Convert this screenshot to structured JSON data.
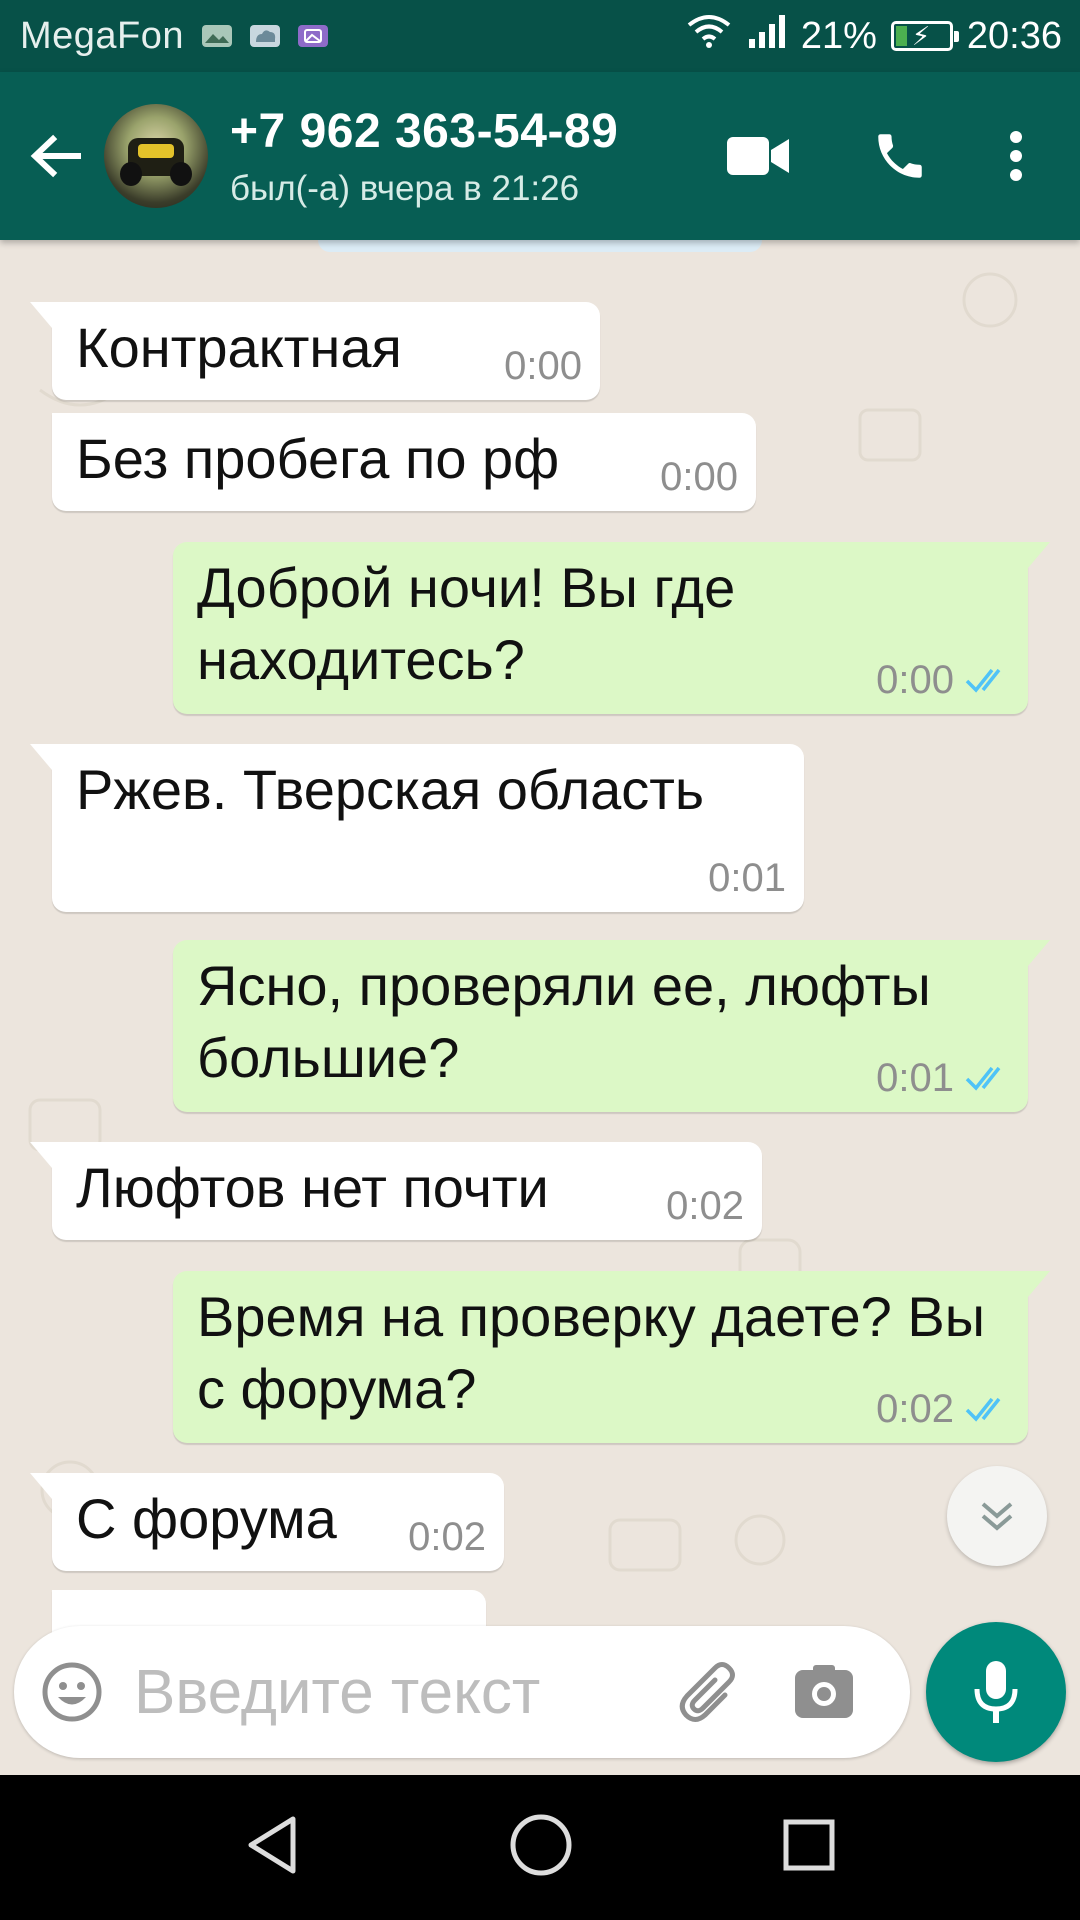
{
  "status_bar": {
    "carrier": "MegaFon",
    "battery": "21%",
    "battery_level": 0.21,
    "time": "20:36",
    "colors": {
      "bg": "#075148"
    }
  },
  "header": {
    "contact_name": "+7 962 363-54-89",
    "last_seen": "был(-а) вчера в 21:26",
    "colors": {
      "bg": "#075e54"
    }
  },
  "messages": [
    {
      "direction": "in",
      "text": "Контрактная",
      "time": "0:00"
    },
    {
      "direction": "in",
      "text": "Без пробега по рф",
      "time": "0:00"
    },
    {
      "direction": "out",
      "text": "Доброй ночи! Вы где находитесь?",
      "time": "0:00",
      "status": "read"
    },
    {
      "direction": "in",
      "text": "Ржев. Тверская область",
      "time": "0:01"
    },
    {
      "direction": "out",
      "text": "Ясно, проверяли ее, люфты большие?",
      "time": "0:01",
      "status": "read"
    },
    {
      "direction": "in",
      "text": "Люфтов нет почти",
      "time": "0:02"
    },
    {
      "direction": "out",
      "text": "Время на проверку даете? Вы с форума?",
      "time": "0:02",
      "status": "read"
    },
    {
      "direction": "in",
      "text": "С форума",
      "time": "0:02"
    }
  ],
  "composer": {
    "placeholder": "Введите текст",
    "value": ""
  },
  "colors": {
    "chat_bg": "#ece5dd",
    "incoming_bubble": "#ffffff",
    "outgoing_bubble": "#dcf8c6",
    "read_ticks": "#4fc3f7",
    "fab": "#00897b"
  },
  "icons": {
    "status_bar": [
      "image-icon",
      "cloud-icon",
      "gallery-icon",
      "wifi-icon",
      "signal-icon",
      "battery-icon"
    ],
    "header": [
      "back-arrow-icon",
      "video-call-icon",
      "phone-icon",
      "more-vert-icon"
    ],
    "composer": [
      "emoji-icon",
      "attach-icon",
      "camera-icon",
      "mic-icon"
    ],
    "navigation": [
      "nav-back-icon",
      "nav-home-icon",
      "nav-recents-icon"
    ],
    "chat": [
      "scroll-down-icon",
      "double-check-icon"
    ]
  }
}
